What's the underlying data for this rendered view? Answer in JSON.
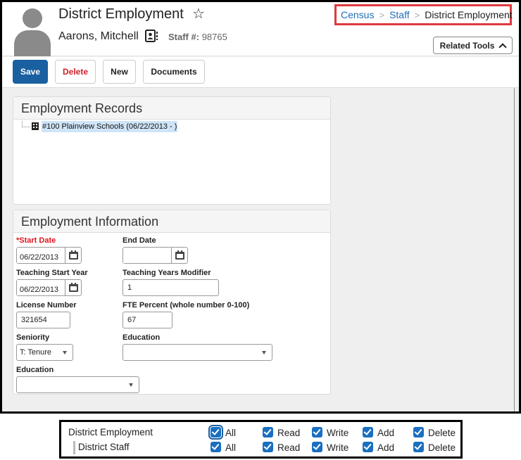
{
  "header": {
    "title": "District Employment",
    "person_name": "Aarons, Mitchell",
    "staff_label": "Staff #:",
    "staff_number": "98765",
    "favorite_icon": "star-outline-icon",
    "contact_icon": "contact-card-icon"
  },
  "breadcrumb": {
    "items": [
      "Census",
      "Staff"
    ],
    "current": "District Employment"
  },
  "related_tools": {
    "label": "Related Tools"
  },
  "toolbar": {
    "save_label": "Save",
    "delete_label": "Delete",
    "new_label": "New",
    "documents_label": "Documents"
  },
  "records": {
    "title": "Employment Records",
    "items": [
      {
        "label": "#100 Plainview Schools (06/22/2013 - )",
        "selected": true,
        "icon": "building-icon"
      }
    ]
  },
  "info": {
    "title": "Employment Information",
    "start_date": {
      "label": "*Start Date",
      "value": "06/22/2013",
      "required": true
    },
    "end_date": {
      "label": "End Date",
      "value": ""
    },
    "teaching_start_year": {
      "label": "Teaching Start Year",
      "value": "06/22/2013"
    },
    "teaching_years_modifier": {
      "label": "Teaching Years Modifier",
      "value": "1"
    },
    "license_number": {
      "label": "License Number",
      "value": "321654"
    },
    "fte_percent": {
      "label": "FTE Percent (whole number 0-100)",
      "value": "67"
    },
    "seniority": {
      "label": "Seniority",
      "value": "T: Tenure"
    },
    "education_1": {
      "label": "Education",
      "value": ""
    },
    "education_2": {
      "label": "Education",
      "value": ""
    }
  },
  "permissions": {
    "options": [
      "All",
      "Read",
      "Write",
      "Add",
      "Delete"
    ],
    "rows": [
      {
        "name": "District Employment",
        "checked": [
          true,
          true,
          true,
          true,
          true
        ]
      },
      {
        "name": "District Staff",
        "checked": [
          true,
          true,
          true,
          true,
          true
        ]
      }
    ]
  },
  "colors": {
    "primary": "#1a5fa0",
    "delete": "#d0202a",
    "required": "#e0141e",
    "link": "#1f6fb2",
    "highlight_box": "#e0383e",
    "checkbox": "#1a6fc0",
    "selection": "#cfe5f7"
  }
}
